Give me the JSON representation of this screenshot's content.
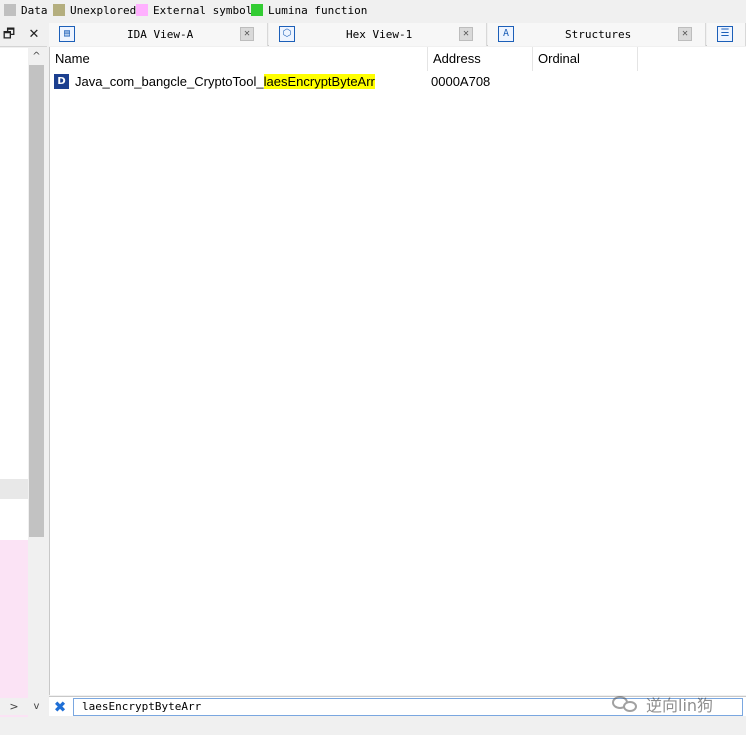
{
  "legend": {
    "items": [
      {
        "label": "Data",
        "color": "#c0c0c0"
      },
      {
        "label": "Unexplored",
        "color": "#b4ae7e"
      },
      {
        "label": "External symbol",
        "color": "#ffb0ff"
      },
      {
        "label": "Lumina function",
        "color": "#33cc33"
      }
    ]
  },
  "left_panel": {
    "float_icon": "float-window-icon",
    "close_icon": "close-icon",
    "scroll_up": "^",
    "scroll_down": "v",
    "scroll_right": ">"
  },
  "tabs": [
    {
      "label": "IDA View-A",
      "icon": "ida-view-icon"
    },
    {
      "label": "Hex View-1",
      "icon": "hex-view-icon"
    },
    {
      "label": "Structures",
      "icon": "structures-icon"
    }
  ],
  "list": {
    "columns": [
      "Name",
      "Address",
      "Ordinal"
    ],
    "rows": [
      {
        "type_badge": "D",
        "name_prefix": "Java_com_bangcle_CryptoTool_",
        "name_match": "laesEncryptByteArr",
        "address": "0000A708",
        "ordinal": ""
      }
    ]
  },
  "filter": {
    "value": "laesEncryptByteArr",
    "clear_icon": "clear-filter-icon"
  },
  "watermark": {
    "text": "逆向lin狗"
  }
}
